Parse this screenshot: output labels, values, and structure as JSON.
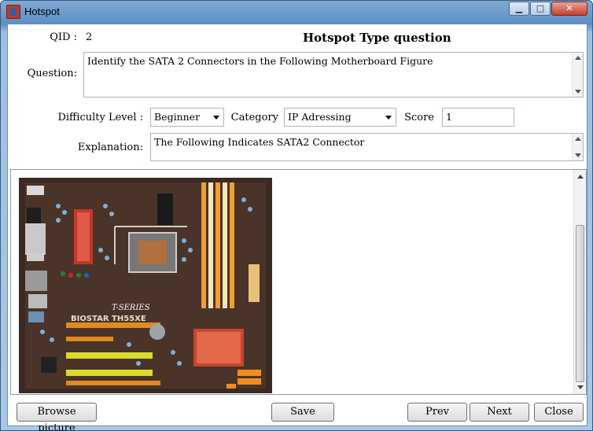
{
  "window": {
    "title": "Hotspot"
  },
  "form": {
    "qid_label": "QID :",
    "qid_value": "2",
    "title": "Hotspot Type question",
    "question_label": "Question:",
    "question_text": "Identify the SATA 2 Connectors in the Following Motherboard Figure",
    "difficulty_label": "Difficulty Level :",
    "difficulty_value": "Beginner",
    "category_label": "Category",
    "category_value": "IP Adressing",
    "score_label": "Score",
    "score_value": "1",
    "explanation_label": "Explanation:",
    "explanation_text": "The Following Indicates SATA2 Connector"
  },
  "image": {
    "board_label": "BIOSTAR TH55XE",
    "board_series": "T-SERIES"
  },
  "buttons": {
    "browse": "Browse picture",
    "save": "Save",
    "prev": "Prev",
    "next": "Next",
    "close": "Close"
  }
}
